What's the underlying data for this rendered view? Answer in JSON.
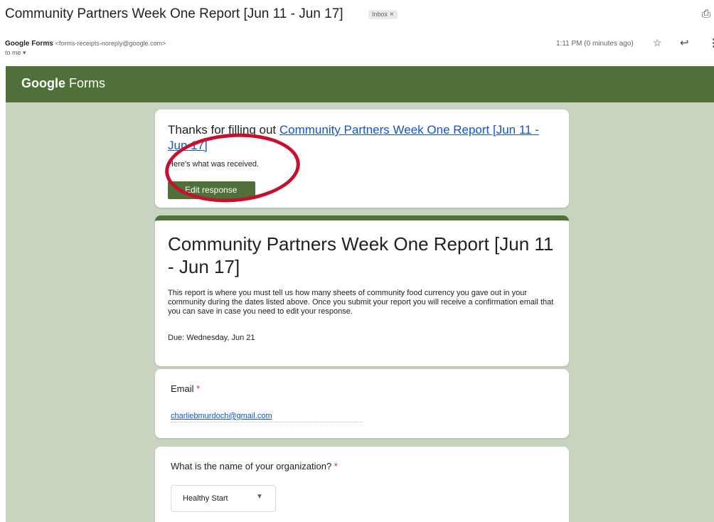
{
  "email": {
    "subject": "Community Partners Week One Report [Jun 11 - Jun 17]",
    "label_chip": "Inbox",
    "label_chip_close": "×",
    "sender_name": "Google Forms",
    "sender_email": "<forms-receipts-noreply@google.com>",
    "to_line": "to me",
    "timestamp": "1:11 PM (0 minutes ago)",
    "icons": {
      "print": "print-icon",
      "star": "star-icon",
      "reply": "reply-icon",
      "more": "more-vert-icon",
      "dropdown": "chevron-down-icon"
    }
  },
  "forms": {
    "logo_google": "Google",
    "logo_forms": "Forms",
    "thanks_prefix": "Thanks for filling out ",
    "thanks_link": "Community Partners Week One Report [Jun 11 - Jun 17]",
    "received_text": "Here's what was received.",
    "edit_button": "Edit response",
    "form_title": "Community Partners Week One Report [Jun 11 - Jun 17]",
    "form_description": "This report is where you must tell us how many sheets of community food currency you gave out in your community during the dates listed above. Once you submit your report you will receive a confirmation email that you can save in case you need to edit your response.",
    "due": "Due: Wednesday, Jun 21",
    "questions": [
      {
        "label": "Email",
        "required_mark": "*",
        "answer": "charliebmurdoch@gmail.com"
      },
      {
        "label": "What is the name of your organization?",
        "required_mark": "*",
        "answer": "Healthy Start"
      }
    ]
  },
  "colors": {
    "header_green": "#4f7038",
    "page_background": "#c8d4c0",
    "link_blue": "#1155cc",
    "annotation_red": "#c8102e"
  }
}
